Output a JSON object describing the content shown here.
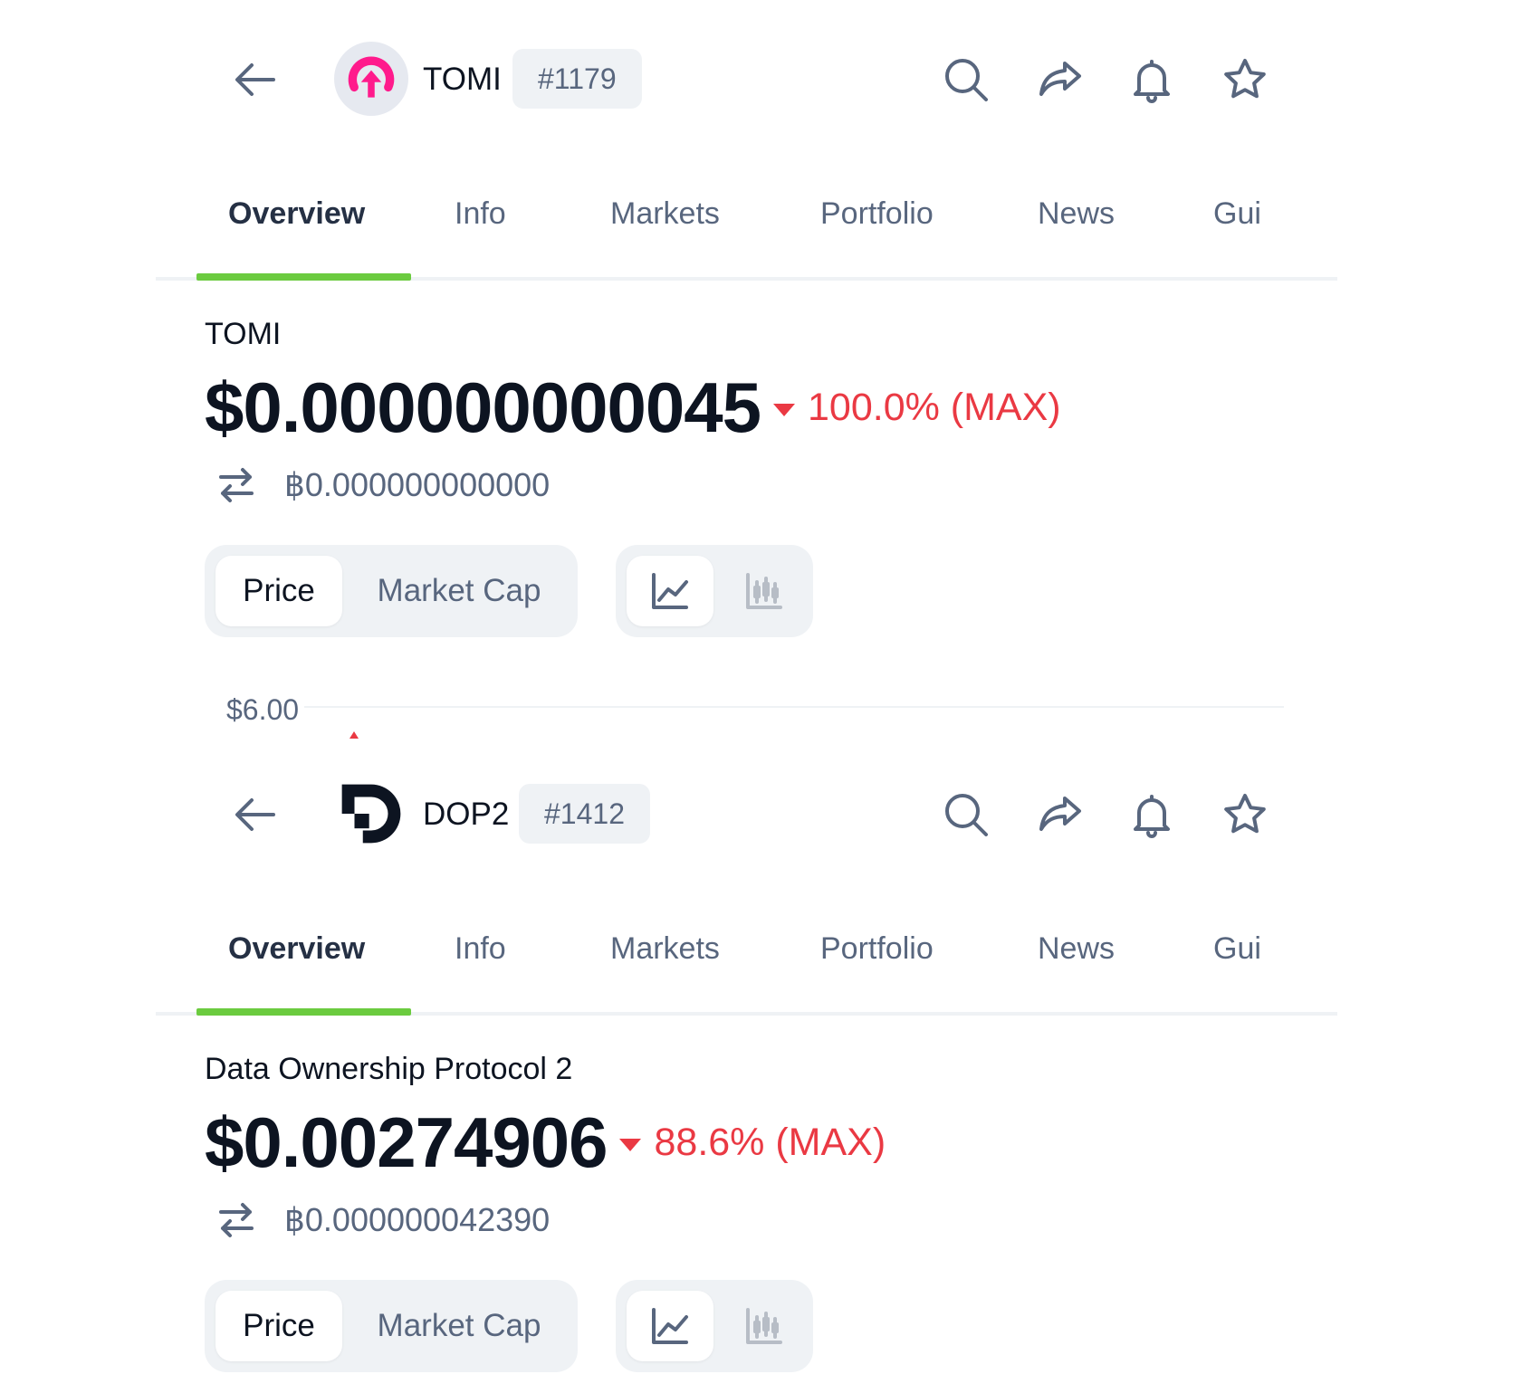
{
  "colors": {
    "accent_green": "#6bcb3f",
    "negative_red": "#ea3943",
    "text_primary": "#0d1421",
    "text_secondary": "#58667e",
    "tomi_logo": "#ff1a8c"
  },
  "tabs": [
    "Overview",
    "Info",
    "Markets",
    "Portfolio",
    "News",
    "Gui"
  ],
  "coins": [
    {
      "symbol": "TOMI",
      "rank": "#1179",
      "logo_icon": "tomi-logo-icon",
      "name": "TOMI",
      "price": "$0.000000000045",
      "change": "100.0% (MAX)",
      "change_direction": "down",
      "btc_price": "฿0.000000000000",
      "metric_options": [
        "Price",
        "Market Cap"
      ],
      "selected_metric": "Price",
      "chart_type_icons": [
        "line-chart-icon",
        "candlestick-chart-icon"
      ],
      "selected_chart_type": "line-chart-icon",
      "chart_top_label": "$6.00"
    },
    {
      "symbol": "DOP2",
      "rank": "#1412",
      "logo_icon": "dop-logo-icon",
      "name": "Data Ownership Protocol 2",
      "price": "$0.00274906",
      "change": "88.6% (MAX)",
      "change_direction": "down",
      "btc_price": "฿0.000000042390",
      "metric_options": [
        "Price",
        "Market Cap"
      ],
      "selected_metric": "Price",
      "chart_type_icons": [
        "line-chart-icon",
        "candlestick-chart-icon"
      ],
      "selected_chart_type": "line-chart-icon"
    }
  ]
}
